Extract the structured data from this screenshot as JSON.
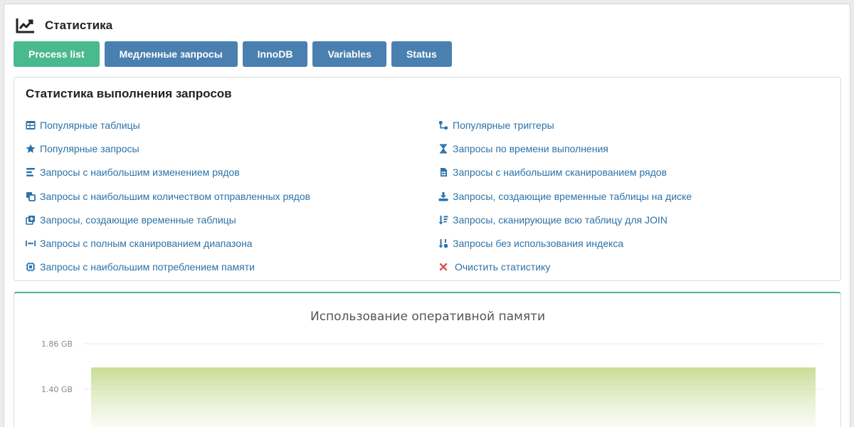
{
  "header": {
    "title": "Статистика",
    "icon": "chart-line-icon"
  },
  "tabs": [
    {
      "label": "Process list",
      "active": true
    },
    {
      "label": "Медленные запросы",
      "active": false
    },
    {
      "label": "InnoDB",
      "active": false
    },
    {
      "label": "Variables",
      "active": false
    },
    {
      "label": "Status",
      "active": false
    }
  ],
  "stats": {
    "title": "Статистика выполнения запросов",
    "left_links": [
      {
        "label": "Популярные таблицы",
        "icon": "table-icon"
      },
      {
        "label": "Популярные запросы",
        "icon": "star-icon"
      },
      {
        "label": "Запросы с наибольшим изменением рядов",
        "icon": "align-left-icon"
      },
      {
        "label": "Запросы с наибольшим количеством отправленных рядов",
        "icon": "clone-icon"
      },
      {
        "label": "Запросы, создающие временные таблицы",
        "icon": "plus-square-icon"
      },
      {
        "label": "Запросы с полным сканированием диапазона",
        "icon": "range-icon"
      },
      {
        "label": "Запросы с наибольшим потреблением памяти",
        "icon": "microchip-icon"
      }
    ],
    "right_links": [
      {
        "label": "Популярные триггеры",
        "icon": "project-diagram-icon"
      },
      {
        "label": "Запросы по времени выполнения",
        "icon": "hourglass-icon"
      },
      {
        "label": "Запросы с наибольшим сканированием рядов",
        "icon": "sim-card-icon"
      },
      {
        "label": "Запросы, создающие временные таблицы на диске",
        "icon": "download-icon"
      },
      {
        "label": "Запросы, сканирующие всю таблицу для JOIN",
        "icon": "sort-amount-icon"
      },
      {
        "label": "Запросы без использования индекса",
        "icon": "sort-numeric-icon"
      },
      {
        "label": "Очистить статистику",
        "icon": "times-icon"
      }
    ]
  },
  "colors": {
    "accent": "#49b98e",
    "tab": "#4a80b0",
    "link": "#2c72a8",
    "danger": "#d9534f"
  },
  "chart_data": {
    "type": "area",
    "title": "Использование оперативной памяти",
    "y_ticks": [
      "1.86 GB",
      "1.40 GB"
    ],
    "y_tick_values": [
      1.86,
      1.4
    ],
    "series": [
      {
        "values": [
          1.62,
          1.62
        ]
      }
    ],
    "ylim": [
      0,
      1.86
    ],
    "grid": true
  }
}
